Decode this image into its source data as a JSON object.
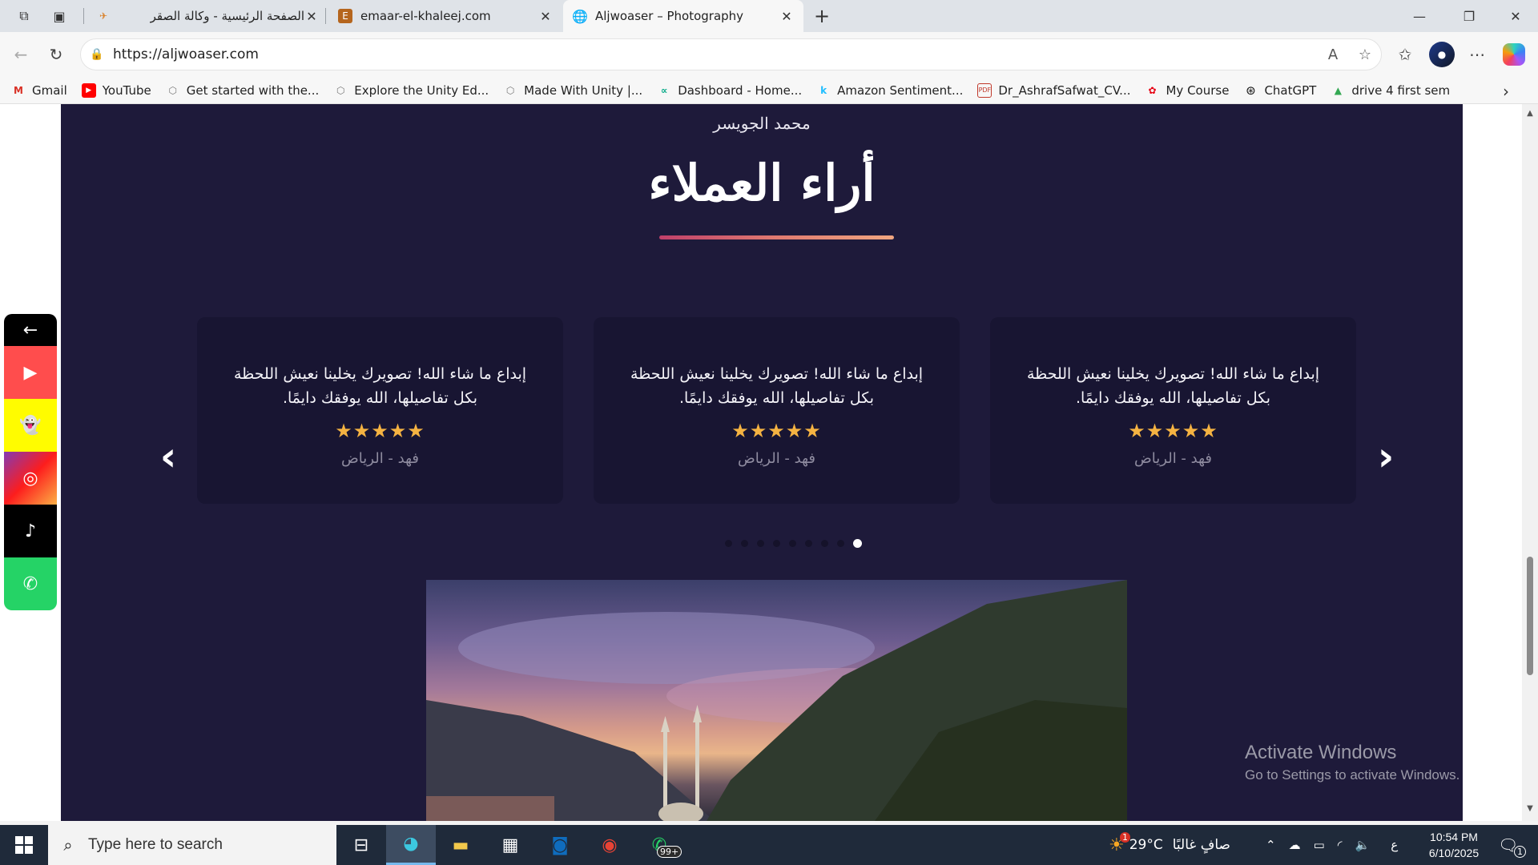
{
  "browser": {
    "tabs": [
      {
        "label": "الصفحة الرئيسية - وكالة الصقر",
        "active": false
      },
      {
        "label": "emaar-el-khaleej.com",
        "active": false
      },
      {
        "label": "Aljwoaser – Photography",
        "active": true
      }
    ],
    "new_tab_label": "+",
    "url": "https://aljwoaser.com",
    "bookmarks": [
      {
        "label": "Gmail",
        "icon": "gmail-icon",
        "color": "#d93025"
      },
      {
        "label": "YouTube",
        "icon": "youtube-icon",
        "color": "#ff0000"
      },
      {
        "label": "Get started with the...",
        "icon": "unity-icon",
        "color": "#777777"
      },
      {
        "label": "Explore the Unity Ed...",
        "icon": "unity-icon",
        "color": "#777777"
      },
      {
        "label": "Made With Unity |...",
        "icon": "unity-icon",
        "color": "#777777"
      },
      {
        "label": "Dashboard - Home...",
        "icon": "dashboard-icon",
        "color": "#00a884"
      },
      {
        "label": "Amazon Sentiment...",
        "icon": "kaggle-icon",
        "color": "#20beff"
      },
      {
        "label": "Dr_AshrafSafwat_CV...",
        "icon": "pdf-icon",
        "color": "#c0392b"
      },
      {
        "label": "My Course",
        "icon": "huawei-icon",
        "color": "#e60012"
      },
      {
        "label": "ChatGPT",
        "icon": "chatgpt-icon",
        "color": "#111111"
      },
      {
        "label": "drive 4 first sem",
        "icon": "google-drive-icon",
        "color": "#34a853"
      }
    ]
  },
  "page": {
    "author": "محمد الجويسر",
    "heading": "أراء العملاء",
    "testimonials": [
      {
        "quote": "إبداع ما شاء الله! تصويرك يخلينا نعيش اللحظة بكل تفاصيلها، الله يوفقك دايمًا.",
        "stars": "★★★★★",
        "name": "فهد - الرياض"
      },
      {
        "quote": "إبداع ما شاء الله! تصويرك يخلينا نعيش اللحظة بكل تفاصيلها، الله يوفقك دايمًا.",
        "stars": "★★★★★",
        "name": "فهد - الرياض"
      },
      {
        "quote": "إبداع ما شاء الله! تصويرك يخلينا نعيش اللحظة بكل تفاصيلها، الله يوفقك دايمًا.",
        "stars": "★★★★★",
        "name": "فهد - الرياض"
      }
    ],
    "prev_arrow": "‹",
    "next_arrow": "›",
    "carousel_dots": 9,
    "carousel_active_dot": 9,
    "social_back": "←",
    "social_links": [
      {
        "name": "youtube",
        "color": "#ff4d4d",
        "glyph": "▶"
      },
      {
        "name": "snapchat",
        "color": "#fffc00",
        "glyph": "👻"
      },
      {
        "name": "instagram",
        "color": "#c13584",
        "glyph": "◎"
      },
      {
        "name": "tiktok",
        "color": "#000000",
        "glyph": "♪"
      },
      {
        "name": "whatsapp",
        "color": "#25d366",
        "glyph": "✆"
      }
    ]
  },
  "watermark": {
    "line1": "Activate Windows",
    "line2": "Go to Settings to activate Windows."
  },
  "taskbar": {
    "search_placeholder": "Type here to search",
    "whatsapp_badge": "99+",
    "weather_temp": "29°C",
    "weather_desc": "صافٍ غالبًا",
    "weather_badge": "1",
    "language": "ع",
    "time": "10:54 PM",
    "date": "6/10/2025",
    "notification_count": "1"
  }
}
